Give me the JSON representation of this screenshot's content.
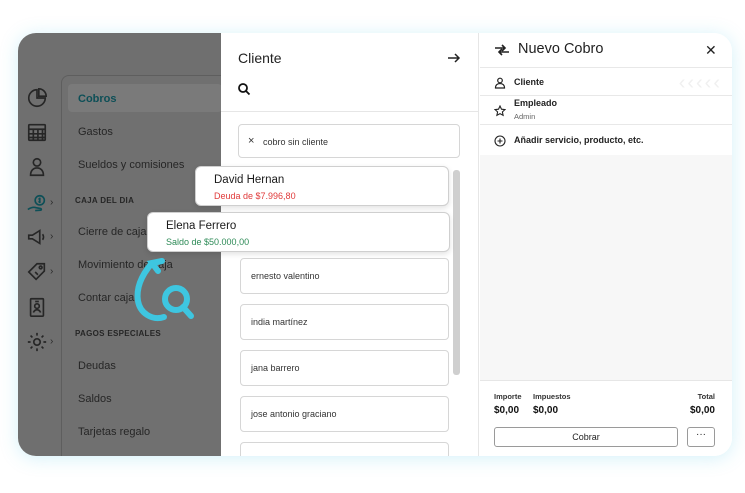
{
  "sidebar": {
    "submenu": {
      "items": [
        "Cobros",
        "Gastos",
        "Sueldos y comisiones"
      ],
      "section_caja": "CAJA DEL DIA",
      "caja_items": [
        "Cierre de caja",
        "Movimiento de caja",
        "Contar caja"
      ],
      "section_pagos": "PAGOS ESPECIALES",
      "pagos_items": [
        "Deudas",
        "Saldos",
        "Tarjetas regalo"
      ]
    }
  },
  "client_panel": {
    "title": "Cliente",
    "no_client_label": "cobro sin cliente",
    "clients": [
      "ernesto valentino",
      "india martínez",
      "jana barrero",
      "jose antonio graciano"
    ]
  },
  "popups": [
    {
      "name": "David Hernan",
      "detail": "Deuda de $7.996,80",
      "color": "#e03a3a"
    },
    {
      "name": "Elena Ferrero",
      "detail": "Saldo de $50.000,00",
      "color": "#2e8b57"
    }
  ],
  "sale_panel": {
    "title": "Nuevo Cobro",
    "client_label": "Cliente",
    "employee_label": "Empleado",
    "employee_value": "Admin",
    "add_label": "Añadir servicio, producto, etc.",
    "totals": {
      "importe_label": "Importe",
      "importe_value": "$0,00",
      "impuestos_label": "Impuestos",
      "impuestos_value": "$0,00",
      "total_label": "Total",
      "total_value": "$0,00"
    },
    "charge_button": "Cobrar",
    "more_button": "···"
  },
  "colors": {
    "accent": "#3ec6e0",
    "active_text": "#0d4f57",
    "debt": "#e03a3a",
    "balance": "#2e8b57"
  }
}
